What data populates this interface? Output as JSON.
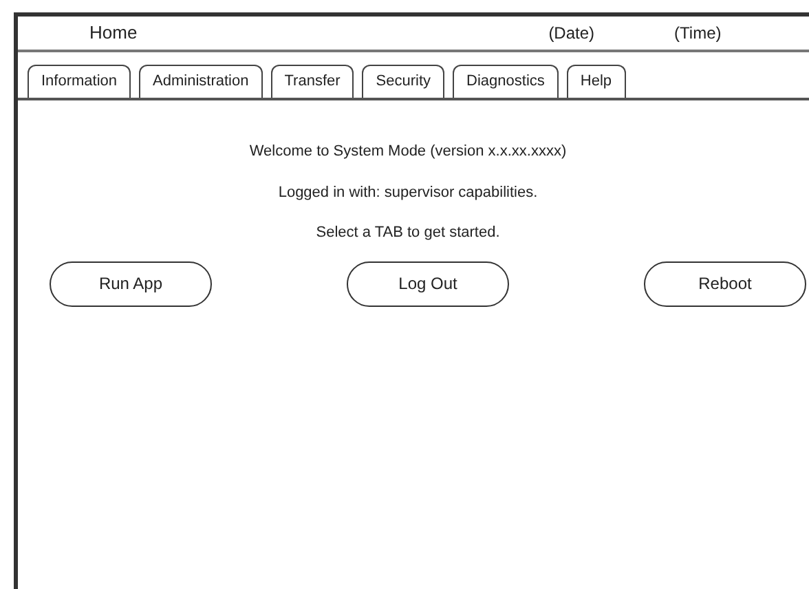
{
  "header": {
    "title": "Home",
    "date": "(Date)",
    "time": "(Time)"
  },
  "tabs": [
    {
      "label": "Information"
    },
    {
      "label": "Administration"
    },
    {
      "label": "Transfer"
    },
    {
      "label": "Security"
    },
    {
      "label": "Diagnostics"
    },
    {
      "label": "Help"
    }
  ],
  "messages": [
    "Welcome to System Mode (version x.x.xx.xxxx)",
    "Logged in with: supervisor capabilities.",
    "Select a TAB to get started."
  ],
  "buttons": [
    "Run App",
    "Log Out",
    "Reboot"
  ]
}
